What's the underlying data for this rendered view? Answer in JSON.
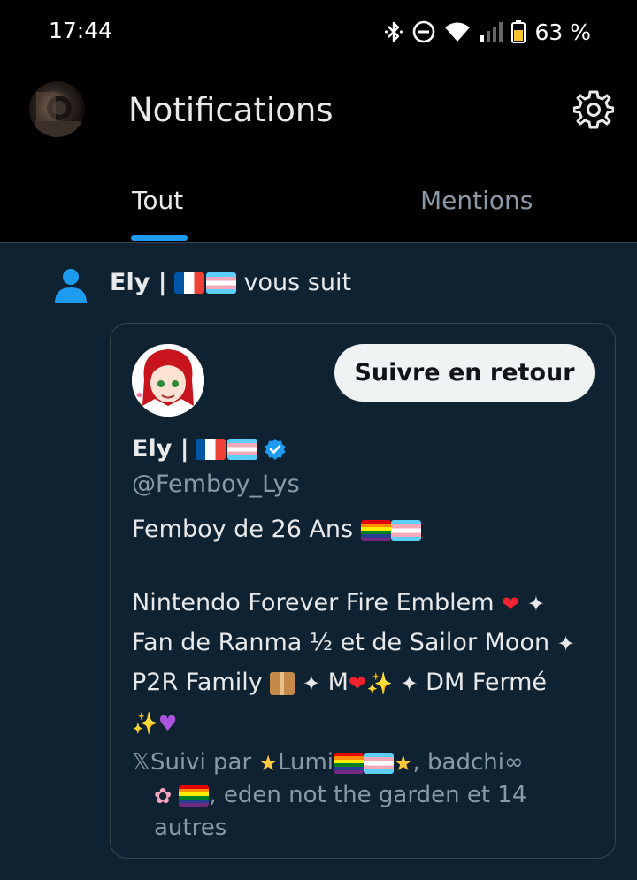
{
  "status_bar": {
    "time": "17:44",
    "battery_percent": "63 %",
    "icons": [
      "bluetooth-icon",
      "do-not-disturb-icon",
      "wifi-icon",
      "signal-icon",
      "battery-icon"
    ]
  },
  "header": {
    "title": "Notifications",
    "settings_icon": "gear-icon"
  },
  "tabs": [
    {
      "label": "Tout",
      "active": true
    },
    {
      "label": "Mentions",
      "active": false
    }
  ],
  "notification": {
    "type": "follow",
    "user_name": "Ely |",
    "action_text": "vous suit",
    "card": {
      "button_label": "Suivre en retour",
      "display_name": "Ely |",
      "verified": true,
      "handle": "@Femboy_Lys",
      "bio_line_1": "Femboy de 26 Ans",
      "bio_line_2": "Nintendo Forever Fire Emblem",
      "bio_line_3": "Fan de Ranma ½ et de Sailor Moon",
      "bio_line_4a": "P2R Family",
      "bio_line_4b": "M",
      "bio_line_4c": "DM Fermé",
      "followed_by_prefix": "𝕏Suivi par",
      "followed_by_1": "Lumi",
      "followed_by_2": ", badchi∞",
      "followed_by_3": ", eden not the garden et 14",
      "followed_by_4": "autres"
    }
  },
  "colors": {
    "accent": "#1d9bf0",
    "background": "#0f2231",
    "header_bg": "#000000",
    "muted_text": "#8b98a5"
  }
}
